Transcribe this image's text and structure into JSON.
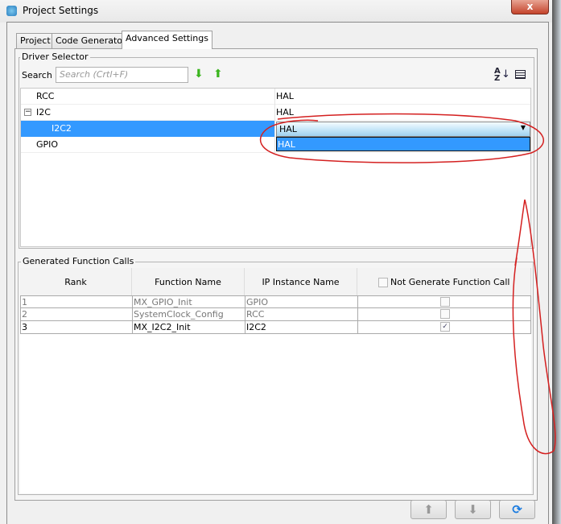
{
  "window": {
    "title": "Project Settings",
    "close_label": "x"
  },
  "tabs": [
    {
      "label": "Project"
    },
    {
      "label": "Code Generator"
    },
    {
      "label": "Advanced Settings",
      "active": true
    }
  ],
  "driver_selector": {
    "title": "Driver Selector",
    "search_label": "Search :",
    "search_placeholder": "Search (Crtl+F)",
    "rows": [
      {
        "name": "RCC",
        "value": "HAL"
      },
      {
        "name": "I2C",
        "value": "HAL",
        "expanded": true
      },
      {
        "name": "I2C2",
        "value": "HAL",
        "selected": true
      },
      {
        "name": "GPIO",
        "value": ""
      }
    ],
    "dropdown_option": "HAL"
  },
  "function_calls": {
    "title": "Generated Function Calls",
    "headers": [
      "Rank",
      "Function Name",
      "IP Instance Name",
      "Not Generate Function Call"
    ],
    "rows": [
      {
        "rank": "1",
        "function": "MX_GPIO_Init",
        "instance": "GPIO",
        "not_generate": false,
        "disabled": true
      },
      {
        "rank": "2",
        "function": "SystemClock_Config",
        "instance": "RCC",
        "not_generate": false,
        "disabled": true
      },
      {
        "rank": "3",
        "function": "MX_I2C2_Init",
        "instance": "I2C2",
        "not_generate": true,
        "disabled": false
      }
    ]
  },
  "colors": {
    "selection": "#3399ff",
    "annotation": "#d42020"
  }
}
